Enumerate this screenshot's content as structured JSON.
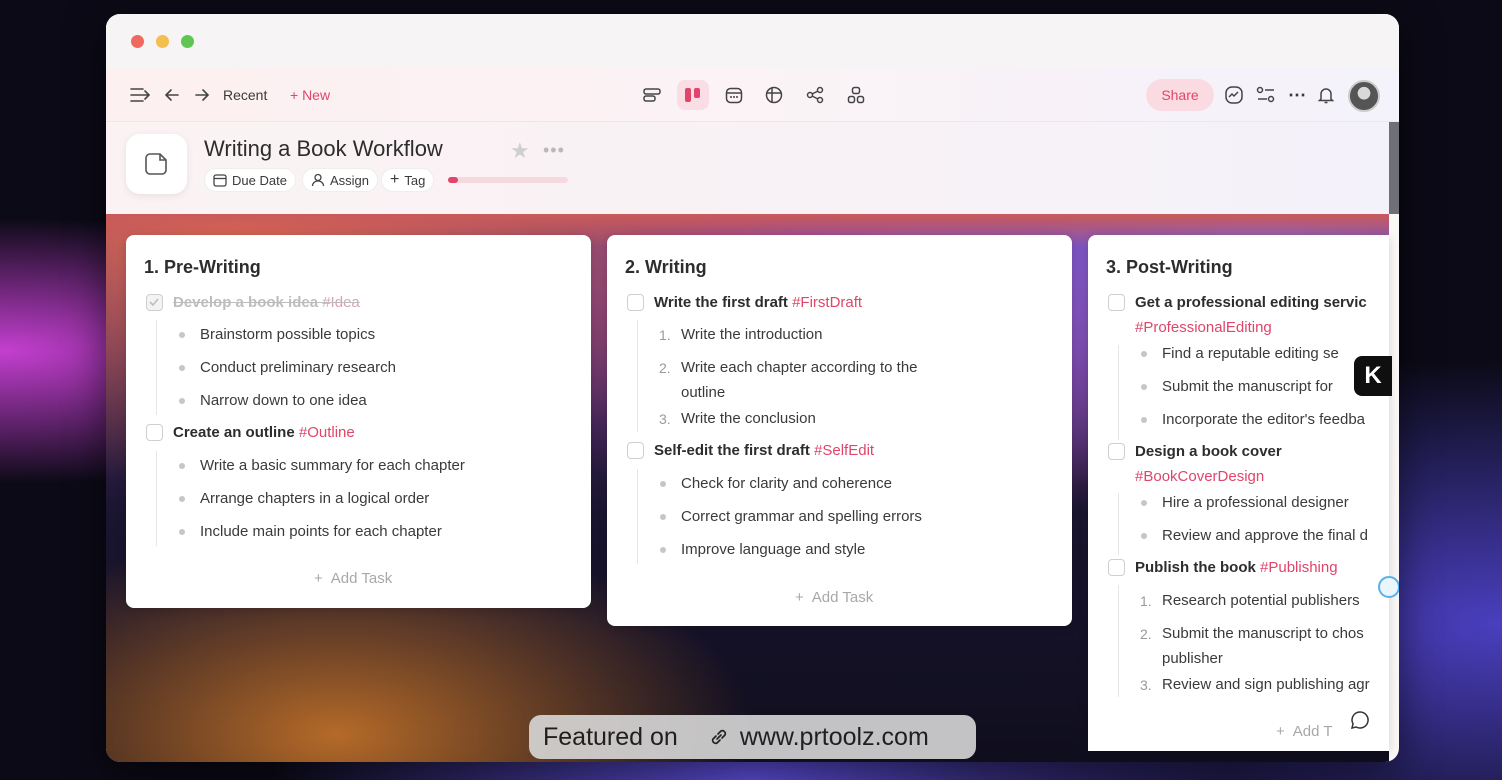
{
  "toolbar": {
    "recent_label": "Recent",
    "new_label": "+ New",
    "share_label": "Share",
    "center_icons": [
      "list-view-icon",
      "board-view-icon",
      "calendar-view-icon",
      "table-view-icon",
      "mindmap-view-icon",
      "org-view-icon"
    ]
  },
  "header": {
    "title": "Writing a Book Workflow",
    "chips": {
      "due_date": "Due Date",
      "assign": "Assign",
      "tag": "Tag"
    },
    "progress": 0.08
  },
  "columns": [
    {
      "title": "1. Pre-Writing",
      "tasks": [
        {
          "text": "Develop a book idea",
          "tag": "#Idea",
          "done": true,
          "subs": [
            "Brainstorm possible topics",
            "Conduct preliminary research",
            "Narrow down to one idea"
          ],
          "list": "bullet"
        },
        {
          "text": "Create an outline",
          "tag": "#Outline",
          "done": false,
          "subs": [
            "Write a basic summary for each chapter",
            "Arrange chapters in a logical order",
            "Include main points for each chapter"
          ],
          "list": "bullet"
        }
      ],
      "add_task": "Add Task"
    },
    {
      "title": "2. Writing",
      "tasks": [
        {
          "text": "Write the first draft",
          "tag": "#FirstDraft",
          "done": false,
          "subs": [
            "Write the introduction",
            "Write each chapter according to the",
            "outline",
            "Write the conclusion"
          ],
          "list": "numbered"
        },
        {
          "text": "Self-edit the first draft",
          "tag": "#SelfEdit",
          "done": false,
          "subs": [
            "Check for clarity and coherence",
            "Correct grammar and spelling errors",
            "Improve language and style"
          ],
          "list": "bullet"
        }
      ],
      "add_task": "Add Task"
    },
    {
      "title": "3. Post-Writing",
      "tasks": [
        {
          "text": "Get a professional editing servic",
          "tag": "#ProfessionalEditing",
          "done": false,
          "subs": [
            "Find a reputable editing se",
            "Submit the manuscript for",
            "Incorporate the editor's feedba"
          ],
          "list": "bullet"
        },
        {
          "text": "Design a book cover",
          "tag": "#BookCoverDesign",
          "done": false,
          "subs": [
            "Hire a professional designer",
            "Review and approve the final d"
          ],
          "list": "bullet"
        },
        {
          "text": "Publish the book",
          "tag": "#Publishing",
          "done": false,
          "subs": [
            "Research potential publishers",
            "Submit the manuscript to chos",
            "publisher",
            "Review and sign publishing agr"
          ],
          "list": "numbered"
        }
      ],
      "add_task": "Add T"
    }
  ],
  "overlay": {
    "featured_label": "Featured on",
    "featured_url": "www.prtoolz.com",
    "badge_letter": "K"
  },
  "colors": {
    "accent": "#e0456a",
    "share_bg": "#fbdbe2"
  }
}
